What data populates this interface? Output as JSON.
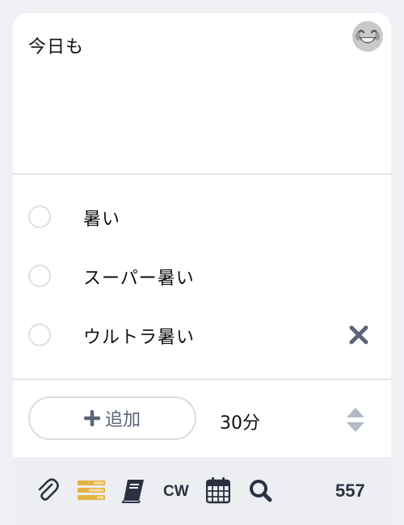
{
  "compose": {
    "text": "今日も"
  },
  "poll": {
    "options": [
      {
        "label": "暑い"
      },
      {
        "label": "スーパー暑い"
      },
      {
        "label": "ウルトラ暑い"
      }
    ],
    "add_label": "追加",
    "duration": "30分"
  },
  "toolbar": {
    "cw_label": "CW",
    "char_count": "557",
    "icons": [
      "paperclip-icon",
      "poll-icon",
      "book-icon",
      "calendar-icon",
      "search-icon"
    ]
  },
  "colors": {
    "poll_active": "#e3b341",
    "icon_dark": "#2c3142",
    "remove": "#5c6478",
    "stepper": "#b3b9c6"
  }
}
